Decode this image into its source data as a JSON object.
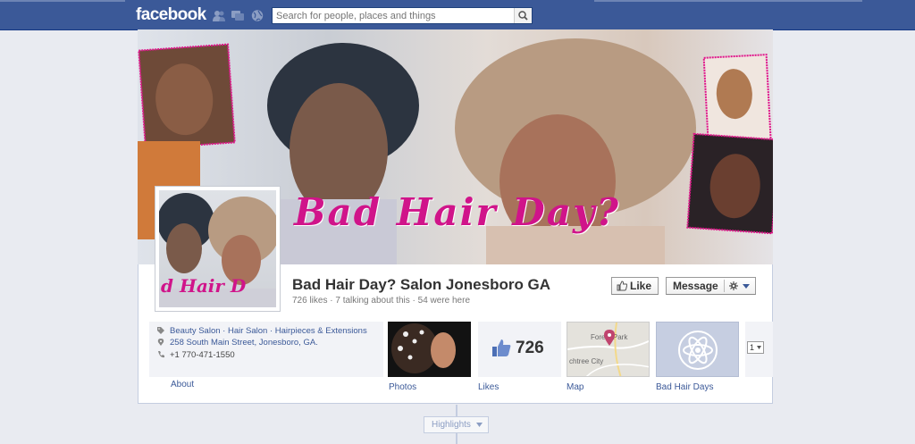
{
  "topbar": {
    "logo": "facebook",
    "search_placeholder": "Search for people, places and things"
  },
  "cover": {
    "text": "Bad Hair Day?"
  },
  "profile": {
    "pic_text": "d Hair D"
  },
  "page": {
    "name": "Bad Hair Day? Salon Jonesboro GA",
    "stats": "726 likes · 7 talking about this · 54 were here"
  },
  "actions": {
    "like_label": "Like",
    "message_label": "Message"
  },
  "info": {
    "categories": "Beauty Salon · Hair Salon · Hairpieces & Extensions",
    "address": "258 South Main Street, Jonesboro, GA.",
    "phone": "+1 770-471-1550",
    "about_label": "About"
  },
  "tiles": {
    "photos_label": "Photos",
    "likes_label": "Likes",
    "likes_count": "726",
    "map_label": "Map",
    "map_text_1": "Forest Park",
    "map_text_2": "chtree City",
    "badhair_label": "Bad Hair Days",
    "more_label": "1"
  },
  "timeline": {
    "highlights_label": "Highlights"
  },
  "colors": {
    "brand": "#3b5998",
    "cover_text": "#d0148a",
    "like_blue": "#4c6fb5"
  }
}
